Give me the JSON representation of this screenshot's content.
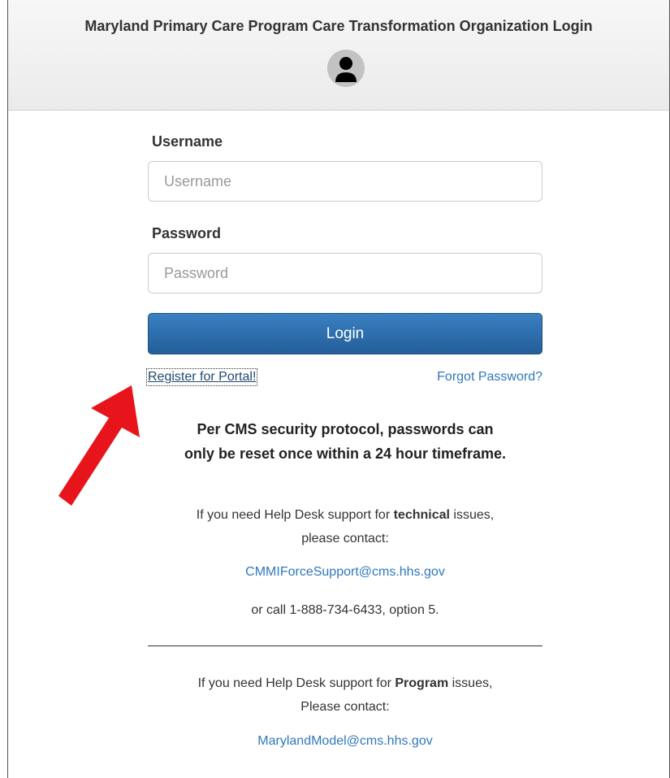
{
  "header": {
    "title": "Maryland Primary Care Program Care Transformation Organization Login",
    "avatar_icon": "user-avatar-icon"
  },
  "form": {
    "username_label": "Username",
    "username_placeholder": "Username",
    "username_value": "",
    "password_label": "Password",
    "password_placeholder": "Password",
    "password_value": "",
    "login_label": "Login",
    "register_link": "Register for Portal!",
    "forgot_link": "Forgot Password?"
  },
  "notice": {
    "line1": "Per CMS security protocol, passwords can",
    "line2": "only be reset once within a 24 hour timeframe."
  },
  "technical_support": {
    "line1_pre": "If you need Help Desk support for ",
    "line1_bold": "technical",
    "line1_post": " issues,",
    "line2": "please contact:",
    "email": "CMMIForceSupport@cms.hhs.gov",
    "phone_line": "or call 1-888-734-6433, option 5."
  },
  "program_support": {
    "line1_pre": "If you need Help Desk support for ",
    "line1_bold": "Program",
    "line1_post": " issues,",
    "line2": "Please contact:",
    "email": "MarylandModel@cms.hhs.gov"
  },
  "annotation": {
    "arrow_icon": "red-arrow-icon",
    "arrow_color": "#e8141b"
  },
  "colors": {
    "button": "#2c6aa8",
    "link": "#2f78ba",
    "header_bg": "#f0f0f0"
  }
}
